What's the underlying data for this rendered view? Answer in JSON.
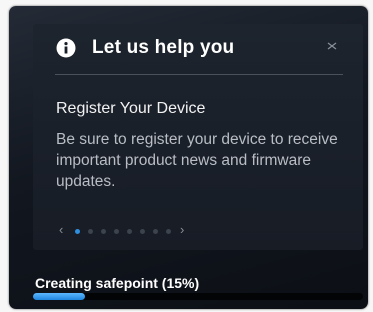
{
  "help_panel": {
    "header_icon": "info-icon",
    "title": "Let us help you",
    "close_icon": "close-icon",
    "card": {
      "title": "Register Your Device",
      "body": "Be sure to register your device to receive important product news and firmware updates."
    },
    "pager": {
      "prev_icon": "chevron-left-icon",
      "next_icon": "chevron-right-icon",
      "prev_glyph": "‹",
      "next_glyph": "›",
      "page_count": 8,
      "active_page": 1
    }
  },
  "status": {
    "label": "Creating safepoint (15%)",
    "progress_fraction": 0.15
  },
  "colors": {
    "accent": "#2e8fe0",
    "background": "#12171f",
    "text_primary": "#ffffff",
    "text_secondary": "#b9bec5"
  }
}
